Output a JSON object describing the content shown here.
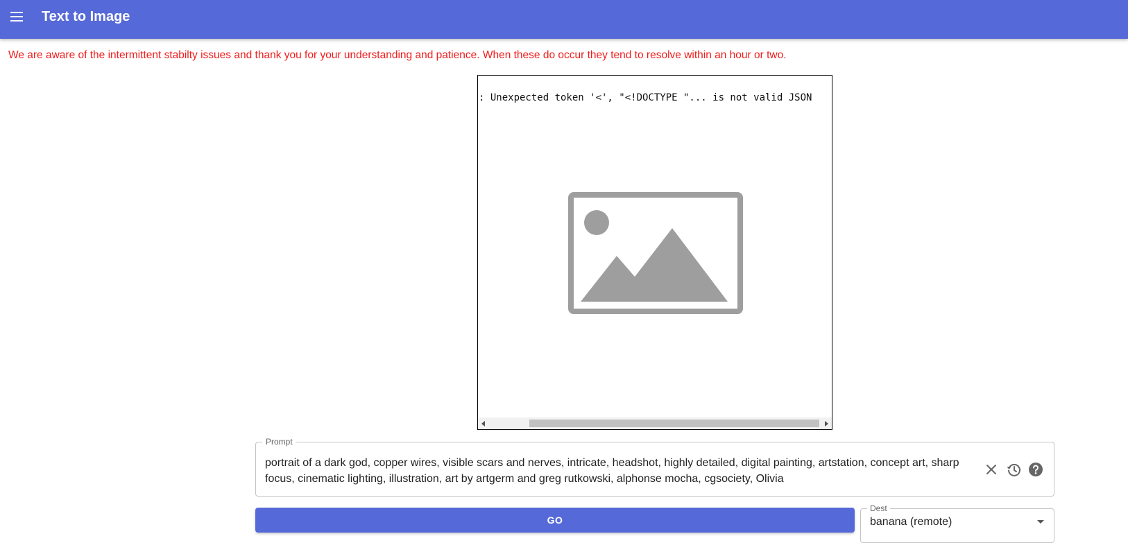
{
  "header": {
    "title": "Text to Image",
    "menu_icon": "hamburger-menu-icon",
    "background": "#5669d8"
  },
  "notice": {
    "text": "We are aware of the intermittent stabilty issues and thank you for your understanding and patience. When these do occur they tend to resolve within an hour or two.",
    "color": "#f01c1c"
  },
  "output": {
    "error_text": ": Unexpected token '<', \"<!DOCTYPE \"... is not valid JSON",
    "placeholder_icon": "image-placeholder-icon"
  },
  "prompt": {
    "label": "Prompt",
    "value": "portrait of a dark god, copper wires, visible scars and nerves, intricate, headshot, highly detailed, digital painting, artstation, concept art, sharp focus, cinematic lighting, illustration, art by artgerm and greg rutkowski, alphonse mocha, cgsociety, Olivia",
    "icons": [
      "clear-icon",
      "history-icon",
      "help-icon"
    ]
  },
  "actions": {
    "go_label": "GO"
  },
  "dest": {
    "label": "Dest",
    "value": "banana (remote)"
  }
}
